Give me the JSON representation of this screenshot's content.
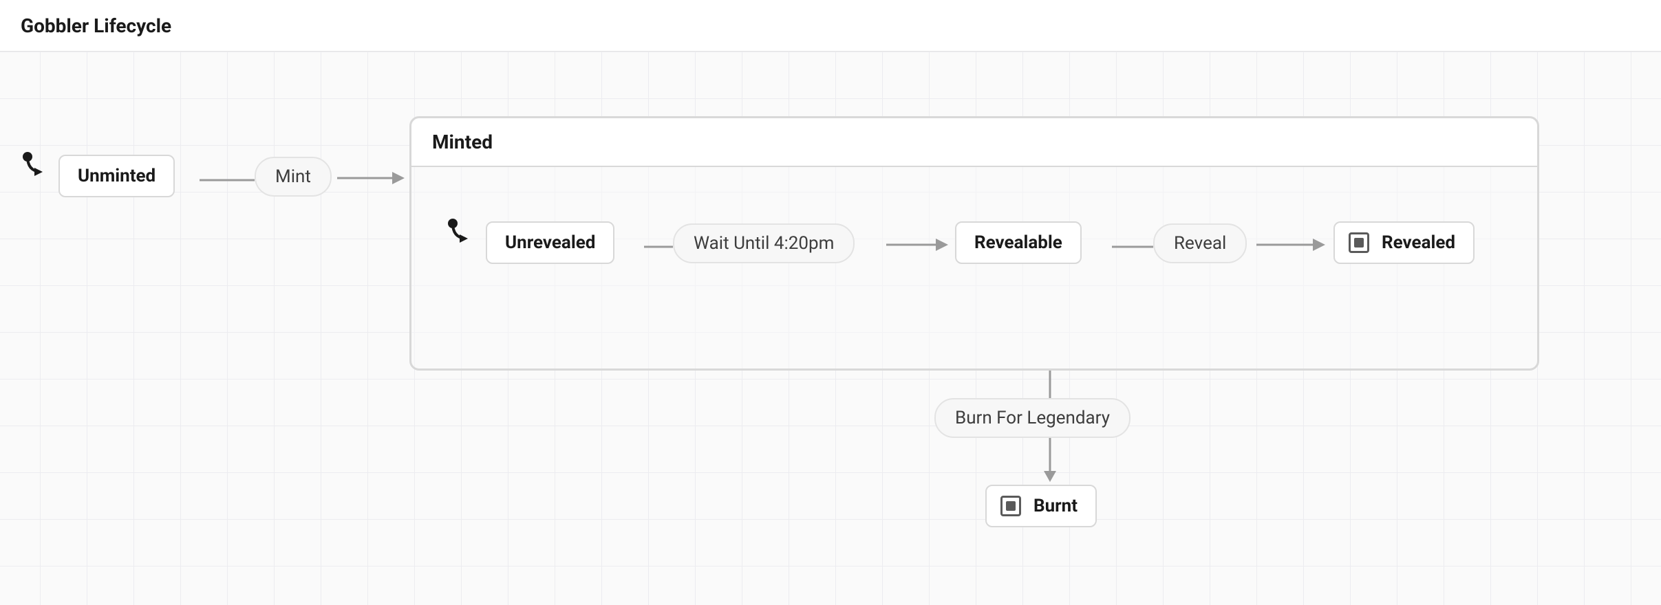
{
  "header": {
    "title": "Gobbler Lifecycle"
  },
  "diagram": {
    "compound": {
      "label": "Minted"
    },
    "states": {
      "unminted": "Unminted",
      "unrevealed": "Unrevealed",
      "revealable": "Revealable",
      "revealed": "Revealed",
      "burnt": "Burnt"
    },
    "actions": {
      "mint": "Mint",
      "wait": "Wait Until 4:20pm",
      "reveal": "Reveal",
      "burn": "Burn For Legendary"
    }
  },
  "colors": {
    "nodeBorder": "#d8d8d8",
    "arrow": "#9a9a9a",
    "text": "#1a1a1a",
    "finalMarker": "#5a5a5a",
    "grid": "#ececf0",
    "canvasBg": "#fafafa"
  }
}
